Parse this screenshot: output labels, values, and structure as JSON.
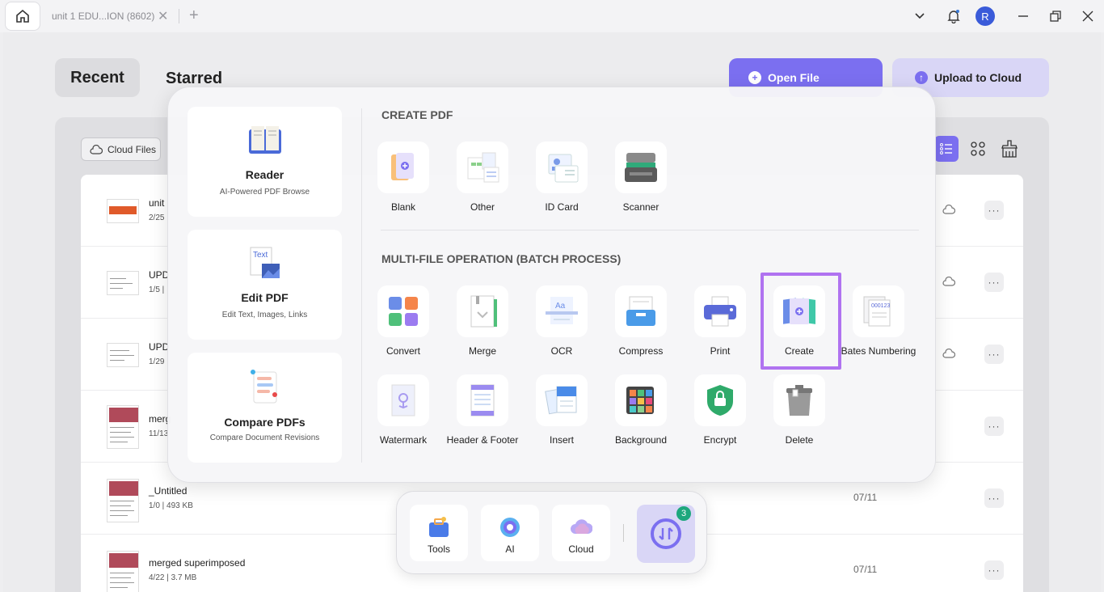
{
  "titlebar": {
    "tab_title": "unit 1 EDU...ION (8602)",
    "tab_close": "✕",
    "tab_add": "+",
    "avatar_letter": "R"
  },
  "tabs": {
    "recent": "Recent",
    "starred": "Starred"
  },
  "actions": {
    "open_file": "Open File",
    "upload_to_cloud": "Upload to Cloud"
  },
  "toolbar": {
    "cloud_files": "Cloud Files"
  },
  "files": [
    {
      "name": "unit",
      "meta": "2/25",
      "date": ""
    },
    {
      "name": "UPD",
      "meta": "1/5 |",
      "date": ""
    },
    {
      "name": "UPD",
      "meta": "1/29",
      "date": ""
    },
    {
      "name": "merg",
      "meta": "11/13",
      "date": ""
    },
    {
      "name": "_Untitled",
      "meta": "1/0 | 493 KB",
      "date": "07/11"
    },
    {
      "name": "merged superimposed",
      "meta": "4/22 | 3.7 MB",
      "date": "07/11"
    }
  ],
  "panel": {
    "side": [
      {
        "title": "Reader",
        "subtitle": "AI-Powered PDF Browse",
        "icon": "reader-icon"
      },
      {
        "title": "Edit PDF",
        "subtitle": "Edit Text, Images, Links",
        "icon": "edit-pdf-icon"
      },
      {
        "title": "Compare PDFs",
        "subtitle": "Compare Document Revisions",
        "icon": "compare-icon"
      }
    ],
    "create_title": "CREATE PDF",
    "create_tools": [
      {
        "label": "Blank",
        "icon": "blank-icon"
      },
      {
        "label": "Other",
        "icon": "other-icon"
      },
      {
        "label": "ID Card",
        "icon": "id-card-icon"
      },
      {
        "label": "Scanner",
        "icon": "scanner-icon"
      }
    ],
    "batch_title": "MULTI-FILE OPERATION (BATCH PROCESS)",
    "batch_tools": [
      {
        "label": "Convert",
        "icon": "convert-icon"
      },
      {
        "label": "Merge",
        "icon": "merge-icon"
      },
      {
        "label": "OCR",
        "icon": "ocr-icon"
      },
      {
        "label": "Compress",
        "icon": "compress-icon"
      },
      {
        "label": "Print",
        "icon": "print-icon"
      },
      {
        "label": "Create",
        "icon": "create-icon"
      },
      {
        "label": "Bates Numbering",
        "icon": "bates-numbering-icon"
      },
      {
        "label": "Watermark",
        "icon": "watermark-icon"
      },
      {
        "label": "Header & Footer",
        "icon": "header-footer-icon"
      },
      {
        "label": "Insert",
        "icon": "insert-icon"
      },
      {
        "label": "Background",
        "icon": "background-icon"
      },
      {
        "label": "Encrypt",
        "icon": "encrypt-icon"
      },
      {
        "label": "Delete",
        "icon": "delete-icon"
      }
    ]
  },
  "dock": {
    "items": [
      {
        "label": "Tools",
        "icon": "tools-icon"
      },
      {
        "label": "AI",
        "icon": "ai-icon"
      },
      {
        "label": "Cloud",
        "icon": "cloud-icon"
      }
    ],
    "batch_badge": "3"
  },
  "colors": {
    "accent": "#7b6ff0",
    "accent_light": "#d9d6f6",
    "highlight": "#b073f0",
    "badge": "#1ea77d"
  }
}
